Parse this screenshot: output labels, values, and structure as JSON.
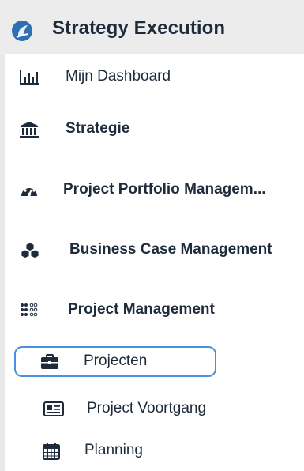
{
  "app": {
    "title": "Strategy Execution",
    "logo_icon": "app-logo-icon"
  },
  "nav": {
    "items": [
      {
        "label": "Mijn Dashboard",
        "icon": "bar-chart-icon"
      },
      {
        "label": "Strategie",
        "icon": "institution-icon"
      },
      {
        "label": "Project Portfolio Managem...",
        "icon": "gauge-icon"
      },
      {
        "label": "Business Case Management",
        "icon": "cubes-icon"
      },
      {
        "label": "Project Management",
        "icon": "dots-grid-icon"
      },
      {
        "label": "Projecten",
        "icon": "briefcase-icon",
        "selected": true
      },
      {
        "label": "Project Voortgang",
        "icon": "newspaper-icon"
      },
      {
        "label": "Planning",
        "icon": "calendar-icon"
      }
    ]
  },
  "colors": {
    "accent": "#4a90e2",
    "header_bg": "#ececec",
    "text": "#1e2b3a"
  }
}
